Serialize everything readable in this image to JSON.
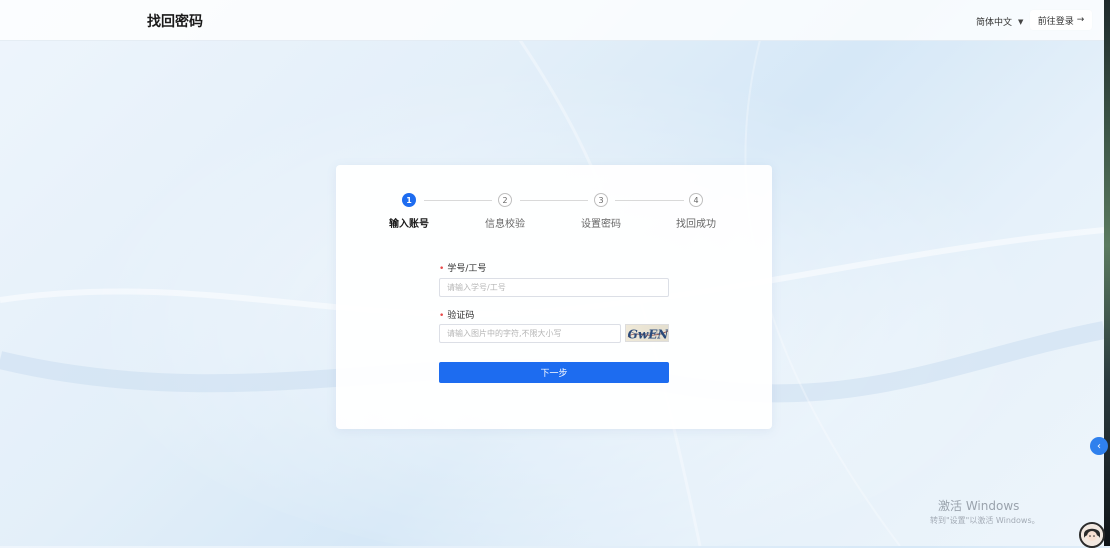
{
  "header": {
    "title": "找回密码",
    "language": "简体中文",
    "goto_login": "前往登录",
    "goto_login_arrow": "→"
  },
  "steps": [
    {
      "number": "1",
      "label": "输入账号",
      "active": true
    },
    {
      "number": "2",
      "label": "信息校验",
      "active": false
    },
    {
      "number": "3",
      "label": "设置密码",
      "active": false
    },
    {
      "number": "4",
      "label": "找回成功",
      "active": false
    }
  ],
  "form": {
    "account_label": "学号/工号",
    "account_placeholder": "请输入学号/工号",
    "captcha_label": "验证码",
    "captcha_placeholder": "请输入图片中的字符,不限大小写",
    "captcha_text": "GwEN",
    "required_mark": "•",
    "next_button": "下一步"
  },
  "watermark": {
    "title": "激活 Windows",
    "subtitle": "转到\"设置\"以激活 Windows。"
  },
  "colors": {
    "primary": "#1d6cf0",
    "required": "#e84a4a"
  },
  "icons": {
    "language_caret": "caret-down-icon",
    "side_toggle": "chevron-left-icon",
    "avatar": "avatar-icon"
  }
}
